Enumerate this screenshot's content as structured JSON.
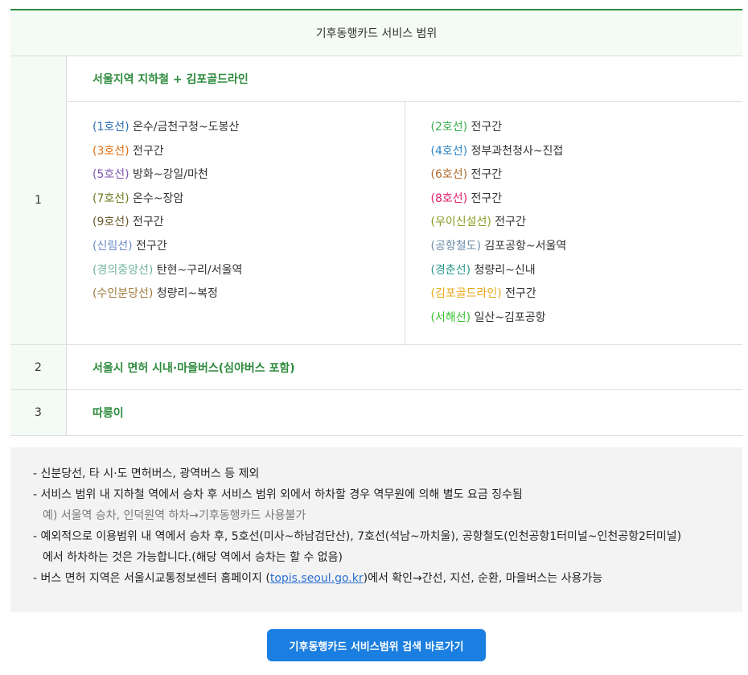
{
  "table": {
    "header": "기후동행카드 서비스 범위",
    "rows": [
      {
        "num": "1",
        "title": "서울지역 지하철 + 김포골드라인",
        "lines_left": [
          {
            "name": "(1호선)",
            "range": " 온수/금천구청~도봉산",
            "color": "#2a6fb5"
          },
          {
            "name": "(3호선)",
            "range": " 전구간",
            "color": "#e06e12"
          },
          {
            "name": "(5호선)",
            "range": " 방화~강일/마천",
            "color": "#7b55b0"
          },
          {
            "name": "(7호선)",
            "range": " 온수~장암",
            "color": "#6b7b1d"
          },
          {
            "name": "(9호선)",
            "range": " 전구간",
            "color": "#6b5a2c"
          },
          {
            "name": "(신림선)",
            "range": " 전구간",
            "color": "#6a8ac8"
          },
          {
            "name": "(경의중앙선)",
            "range": " 탄현~구리/서울역",
            "color": "#6fb49c"
          },
          {
            "name": "(수인분당선)",
            "range": " 청량리~복정",
            "color": "#a07a3c"
          }
        ],
        "lines_right": [
          {
            "name": "(2호선)",
            "range": " 전구간",
            "color": "#3aad4f"
          },
          {
            "name": "(4호선)",
            "range": " 정부과천청사~진접",
            "color": "#2e86c8"
          },
          {
            "name": "(6호선)",
            "range": " 전구간",
            "color": "#b06a2c"
          },
          {
            "name": "(8호선)",
            "range": " 전구간",
            "color": "#e0206c"
          },
          {
            "name": "(우이신설선)",
            "range": " 전구간",
            "color": "#8a9a20"
          },
          {
            "name": "(공항철도)",
            "range": " 김포공항~서울역",
            "color": "#6a8aa8"
          },
          {
            "name": "(경춘선)",
            "range": " 청량리~신내",
            "color": "#2a9a8a"
          },
          {
            "name": "(김포골드라인)",
            "range": " 전구간",
            "color": "#e8a818"
          },
          {
            "name": "(서해선)",
            "range": " 일산~김포공항",
            "color": "#3ac030"
          }
        ]
      },
      {
        "num": "2",
        "title": "서울시 면허 시내·마을버스(심야버스 포함)"
      },
      {
        "num": "3",
        "title": "따릉이"
      }
    ]
  },
  "notes": {
    "n1": "- 신분당선, 타 시·도 면허버스, 광역버스 등 제외",
    "n2": "- 서비스 범위 내 지하철 역에서 승차 후 서비스 범위 외에서 하차할 경우 역무원에 의해 별도 요금 징수됨",
    "n2_example": "예) 서울역 승차, 인덕원역 하차→기후동행카드 사용불가",
    "n3": "- 예외적으로 이용범위 내 역에서 승차 후,  5호선(미사~하남검단산), 7호선(석남~까치울), 공항철도(인천공항1터미널~인천공항2터미널)",
    "n3_cont": "에서 하차하는 것은 가능합니다.(해당 역에서 승차는 할 수 없음)",
    "n4_pre": "- 버스 면허 지역은 서울시교통정보센터 홈페이지 (",
    "n4_link": "topis.seoul.go.kr",
    "n4_post": ")에서 확인→간선, 지선, 순환, 마을버스는 사용가능"
  },
  "cta": {
    "label": "기후동행카드 서비스범위 검색 바로가기"
  }
}
